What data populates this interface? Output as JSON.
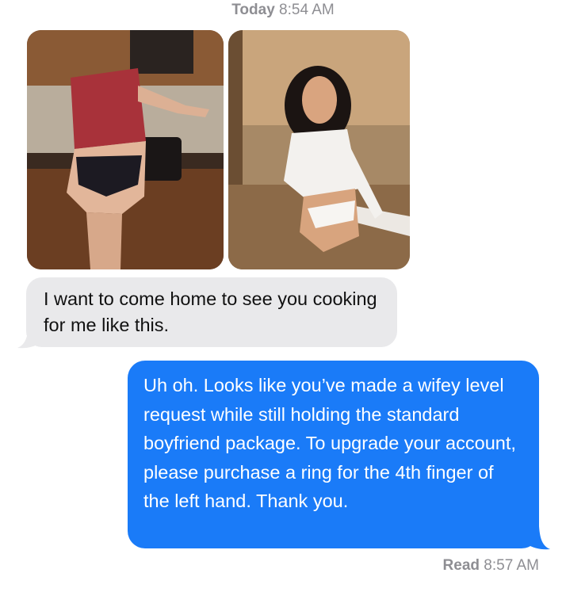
{
  "header": {
    "timestamp_day": "Today",
    "timestamp_time": "8:54 AM"
  },
  "attachments": [
    {
      "icon": "photo-icon",
      "description": "kitchen-photo-1"
    },
    {
      "icon": "photo-icon",
      "description": "kitchen-photo-2"
    }
  ],
  "messages": {
    "received_text": "I want to come home to see you cooking for me like this.",
    "sent_text": "Uh oh. Looks like you’ve made a wifey level request while still holding the standard boyfriend package. To upgrade your account, please purchase a ring for the 4th finger of the left hand. Thank you."
  },
  "footer": {
    "read_label": "Read",
    "read_time": "8:57 AM"
  },
  "colors": {
    "sent_bubble": "#1a7bf8",
    "received_bubble": "#e9e9eb",
    "meta_text": "#8e8e93"
  }
}
